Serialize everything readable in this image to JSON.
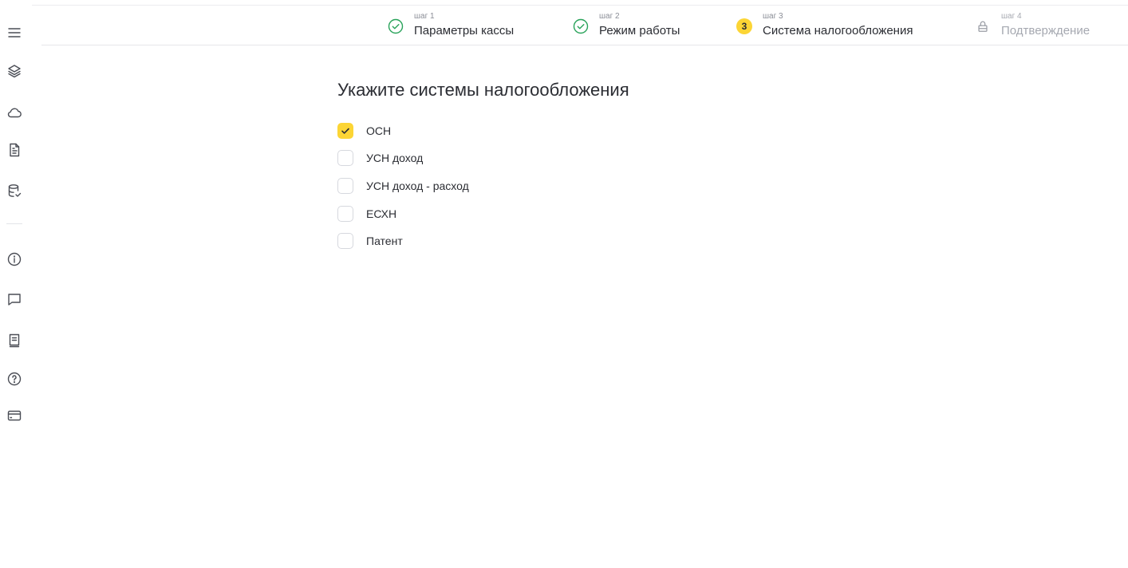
{
  "sidebar": {
    "icons": [
      "menu-icon",
      "layers-icon",
      "cloud-icon",
      "document-icon",
      "database-check-icon",
      "info-icon",
      "chat-icon",
      "book-icon",
      "help-icon",
      "card-icon"
    ]
  },
  "stepper": {
    "steps": [
      {
        "small": "шаг 1",
        "label": "Параметры кассы",
        "state": "done"
      },
      {
        "small": "шаг 2",
        "label": "Режим работы",
        "state": "done"
      },
      {
        "small": "шаг 3",
        "label": "Система налогообложения",
        "state": "active",
        "number": "3"
      },
      {
        "small": "шаг 4",
        "label": "Подтверждение",
        "state": "locked"
      }
    ]
  },
  "main": {
    "title": "Укажите системы налогообложения",
    "options": [
      {
        "label": "ОСН",
        "checked": true
      },
      {
        "label": "УСН доход",
        "checked": false
      },
      {
        "label": "УСН доход - расход",
        "checked": false
      },
      {
        "label": "ЕСХН",
        "checked": false
      },
      {
        "label": "Патент",
        "checked": false
      }
    ]
  },
  "colors": {
    "accent": "#fcd535",
    "success": "#29a35a",
    "text": "#2b2d33",
    "muted": "#a5a8b0"
  }
}
